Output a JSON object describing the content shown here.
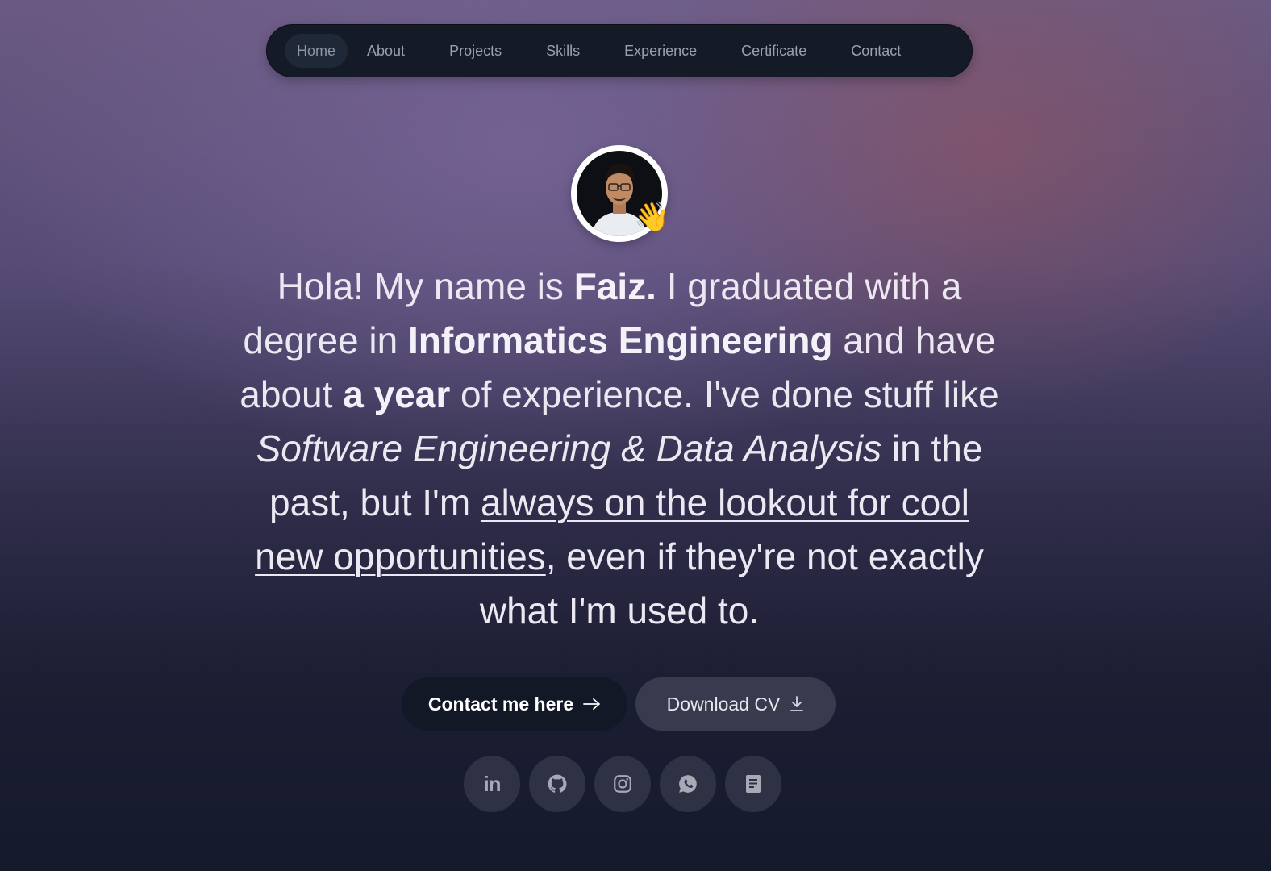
{
  "nav": {
    "items": [
      {
        "label": "Home",
        "active": true
      },
      {
        "label": "About"
      },
      {
        "label": "Projects"
      },
      {
        "label": "Skills"
      },
      {
        "label": "Experience"
      },
      {
        "label": "Certificate"
      },
      {
        "label": "Contact"
      }
    ]
  },
  "hero": {
    "wave_emoji": "👋",
    "intro": {
      "t1": "Hola! My name is ",
      "name": "Faiz.",
      "t2": " I graduated with a degree in ",
      "degree": "Informatics Engineering",
      "t3": " and have about ",
      "duration": "a year",
      "t4": " of experience. I've done stuff like ",
      "fields": "Software Engineering & Data Analysis",
      "t5": " in the past, but I'm ",
      "lookout": "always on the lookout for cool new opportunities",
      "t6": ", even if they're not exactly what I'm used to."
    }
  },
  "actions": {
    "contact_label": "Contact me here",
    "cv_label": "Download CV"
  },
  "socials": {
    "linkedin_text": "in",
    "icons": [
      "linkedin-icon",
      "github-icon",
      "instagram-icon",
      "whatsapp-icon",
      "document-icon"
    ]
  },
  "colors": {
    "nav_bg": "#141a26",
    "primary_button": "#131827",
    "secondary_button": "#383b4e",
    "social_bg": "#2e3244"
  }
}
